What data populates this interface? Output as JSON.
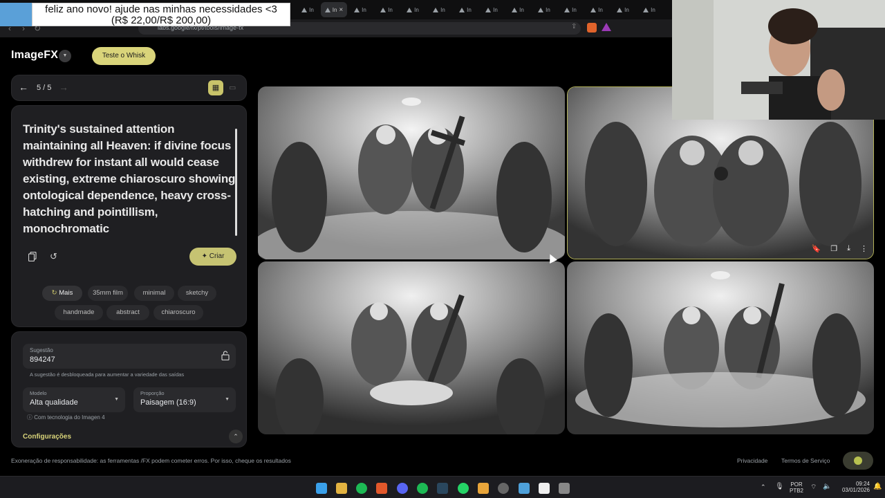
{
  "overlay": {
    "line1": "feliz ano novo! ajude nas minhas necessidades <3",
    "line2": "(R$ 22,00/R$ 200,00)"
  },
  "browser": {
    "url": "labs.google/fx/pt/tools/image-fx",
    "tabs": [
      "In",
      "In",
      "In",
      "In",
      "In",
      "In",
      "In",
      "In",
      "In",
      "In",
      "In",
      "In",
      "In",
      "In"
    ]
  },
  "app": {
    "title": "ImageFX",
    "whisk_button": "Teste o Whisk"
  },
  "nav": {
    "count": "5 / 5"
  },
  "prompt": {
    "text": "Trinity's sustained attention maintaining all Heaven: if divine focus withdrew for instant all would cease existing, extreme chiaroscuro showing ontological dependence, heavy cross-hatching and pointillism, monochromatic",
    "create_label": "Criar"
  },
  "chips": {
    "more": "Mais",
    "items": [
      "35mm film",
      "minimal",
      "sketchy",
      "handmade",
      "abstract",
      "chiaroscuro"
    ]
  },
  "settings": {
    "seed_label": "Sugestão",
    "seed_value": "894247",
    "seed_hint": "A sugestão é desbloqueada para aumentar a variedade das saídas",
    "model_label": "Modelo",
    "model_value": "Alta qualidade",
    "ratio_label": "Proporção",
    "ratio_value": "Paisagem (16:9)",
    "tech": "Com tecnologia do Imagen 4",
    "config": "Configurações"
  },
  "footer": {
    "disclaimer": "Exoneração de responsabilidade: as ferramentas /FX podem cometer erros. Por isso, cheque os resultados",
    "privacy": "Privacidade",
    "terms": "Termos de Serviço"
  },
  "taskbar": {
    "lang1": "POR",
    "lang2": "PTB2",
    "time": "09:24",
    "date": "03/01/2026"
  },
  "icons": [
    "back-arrow-icon",
    "forward-arrow-icon",
    "grid-view-icon",
    "list-view-icon",
    "copy-icon",
    "undo-icon",
    "sparkle-icon",
    "lock-icon",
    "bookmark-icon",
    "download-icon",
    "more-vert-icon"
  ]
}
